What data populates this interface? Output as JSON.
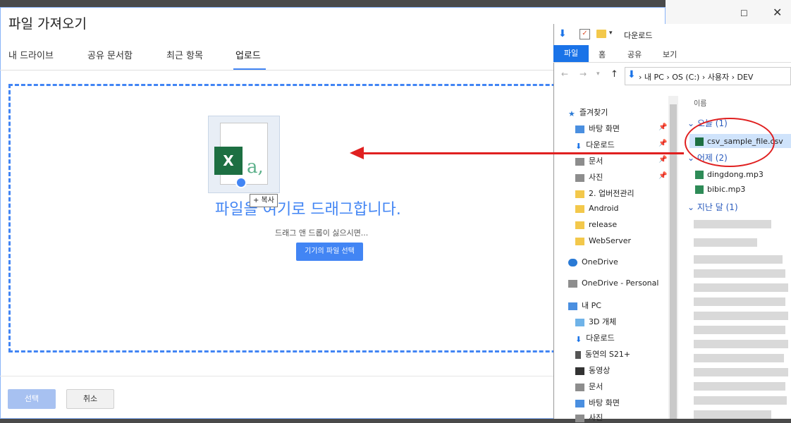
{
  "dialog": {
    "title": "파일 가져오기",
    "tabs": [
      "내 드라이브",
      "공유 문서함",
      "최근 항목",
      "업로드"
    ],
    "active_tab": "업로드",
    "drop_message": "파일을 여기로 드래그합니다.",
    "alt_message": "드래그 앤 드롭이 싫으시면...",
    "device_button": "기기의 파일 선택",
    "drag_badge": "+ 복사",
    "select_button": "선택",
    "cancel_button": "취소",
    "accent_color": "#4285f4"
  },
  "explorer": {
    "title": "다운로드",
    "ribbon_tabs": [
      "파일",
      "홈",
      "공유",
      "보기"
    ],
    "address_path": "› 내 PC › OS (C:) › 사용자 › DEV",
    "nav_items": [
      {
        "label": "즐겨찾기",
        "icon": "star-icon"
      },
      {
        "label": "바탕 화면",
        "icon": "desktop-icon"
      },
      {
        "label": "다운로드",
        "icon": "download-icon"
      },
      {
        "label": "문서",
        "icon": "document-icon"
      },
      {
        "label": "사진",
        "icon": "picture-icon"
      },
      {
        "label": "2. 업버전관리",
        "icon": "folder-icon"
      },
      {
        "label": "Android",
        "icon": "folder-icon"
      },
      {
        "label": "release",
        "icon": "folder-icon"
      },
      {
        "label": "WebServer",
        "icon": "folder-icon"
      },
      {
        "label": "OneDrive",
        "icon": "cloud-icon"
      },
      {
        "label": "OneDrive - Personal",
        "icon": "cloud-icon"
      },
      {
        "label": "내 PC",
        "icon": "computer-icon"
      },
      {
        "label": "3D 개체",
        "icon": "cube-icon"
      },
      {
        "label": "다운로드",
        "icon": "download-icon"
      },
      {
        "label": "동연의 S21+",
        "icon": "phone-icon"
      },
      {
        "label": "동영상",
        "icon": "video-icon"
      },
      {
        "label": "문서",
        "icon": "document-icon"
      },
      {
        "label": "바탕 화면",
        "icon": "desktop-icon"
      },
      {
        "label": "사진",
        "icon": "picture-icon"
      }
    ],
    "column_header": "이름",
    "groups": [
      {
        "label": "오늘 (1)"
      },
      {
        "label": "어제 (2)"
      },
      {
        "label": "지난 달 (1)"
      }
    ],
    "files": [
      "csv_sample_file.csv",
      "dingdong.mp3",
      "bibic.mp3"
    ]
  }
}
